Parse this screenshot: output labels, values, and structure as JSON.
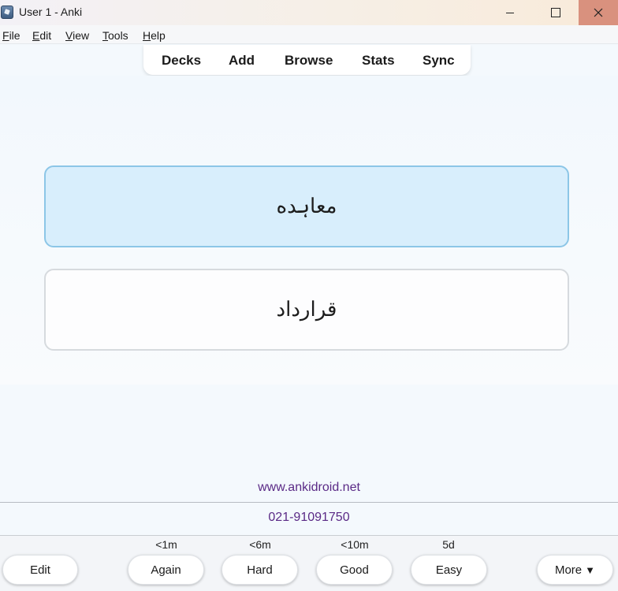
{
  "window": {
    "title": "User 1 - Anki"
  },
  "menu": [
    {
      "key": "F",
      "rest": "ile"
    },
    {
      "key": "E",
      "rest": "dit"
    },
    {
      "key": "V",
      "rest": "iew"
    },
    {
      "key": "T",
      "rest": "ools"
    },
    {
      "key": "H",
      "rest": "elp"
    }
  ],
  "toolbar": {
    "decks": "Decks",
    "add": "Add",
    "browse": "Browse",
    "stats": "Stats",
    "sync": "Sync"
  },
  "card": {
    "option_1": "معاہده",
    "option_2": "قرارداد"
  },
  "footer": {
    "website": "www.ankidroid.net",
    "phone": "021-91091750"
  },
  "intervals": {
    "again": "<1m",
    "hard": "<6m",
    "good": "<10m",
    "easy": "5d"
  },
  "buttons": {
    "edit": "Edit",
    "again": "Again",
    "hard": "Hard",
    "good": "Good",
    "easy": "Easy",
    "more": "More",
    "more_arrow": "▼"
  }
}
